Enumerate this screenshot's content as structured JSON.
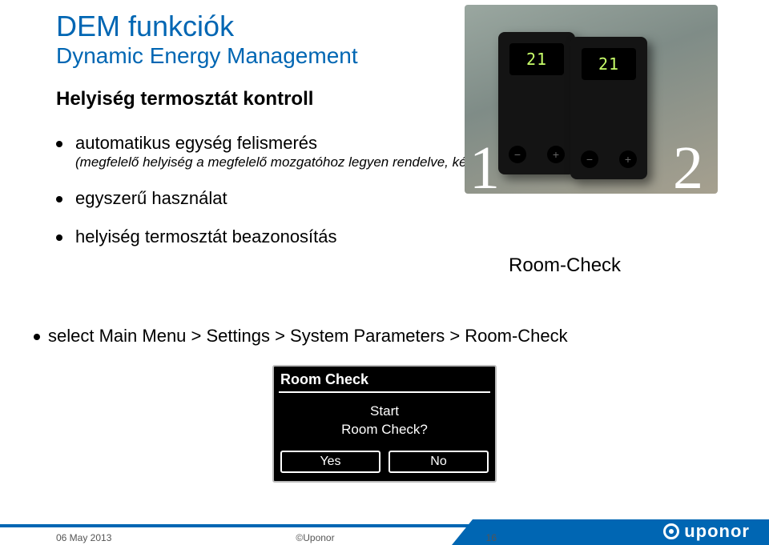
{
  "title": "DEM funkciók",
  "subtitle": "Dynamic Energy Management",
  "section": "Helyiség termosztát kontroll",
  "bullets": [
    {
      "main": "automatikus egység felismerés ",
      "desc": "(megfelelő helyiség a megfelelő mozgatóhoz legyen rendelve, kézi címzés)"
    },
    {
      "main": "egyszerű használat"
    },
    {
      "main": "helyiség termosztát beazonosítás"
    }
  ],
  "room_check_label": "Room-Check",
  "menu_path": "select Main Menu > Settings > System Parameters > Room-Check",
  "illustration": {
    "device1_reading": "21",
    "device2_reading": "21",
    "tag1": "1",
    "tag2": "2",
    "btn_minus": "−",
    "btn_plus": "+"
  },
  "dialog": {
    "title": "Room Check",
    "line1": "Start",
    "line2": "Room Check?",
    "yes": "Yes",
    "no": "No"
  },
  "footer": {
    "date": "06 May 2013",
    "copyright": "©Uponor",
    "page": "16",
    "brand": "uponor"
  }
}
